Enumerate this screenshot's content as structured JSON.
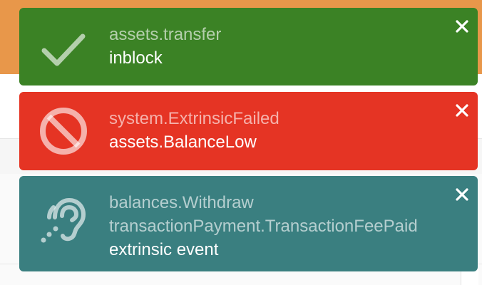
{
  "colors": {
    "success": "#3b8225",
    "error": "#e53424",
    "info": "#3a7f80",
    "page_topbar": "#e8974a"
  },
  "notifications": [
    {
      "status": "success",
      "icon": "check-icon",
      "section": "assets.transfer",
      "message": "inblock",
      "close_icon": "close-icon"
    },
    {
      "status": "error",
      "icon": "ban-icon",
      "section": "system.ExtrinsicFailed",
      "message": "assets.BalanceLow",
      "close_icon": "close-icon"
    },
    {
      "status": "event",
      "icon": "assistive-listening-icon",
      "sections": [
        "balances.Withdraw",
        "transactionPayment.TransactionFeePaid"
      ],
      "message": "extrinsic event",
      "close_icon": "close-icon"
    }
  ]
}
